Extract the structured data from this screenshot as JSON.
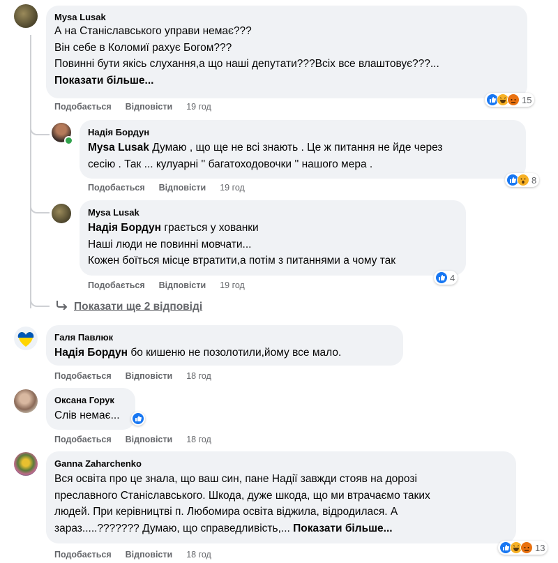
{
  "actions": {
    "like": "Подобається",
    "reply": "Відповісти"
  },
  "comments": [
    {
      "author": "Mysa Lusak",
      "lines": [
        "А на Станіславського управи немає???",
        "Він себе в Коломиї рахує Богом???",
        "Повинні бути якісь слухання,а що наші депутати???Всіх все влаштовує???..."
      ],
      "more": "Показати більше...",
      "time": "19 год",
      "reaction_count": "15",
      "reaction_icons": [
        "like-icon",
        "haha-icon",
        "angry-icon"
      ]
    },
    {
      "author": "Надія Бордун",
      "mention": "Mysa Lusak",
      "line1": "Думаю , що ще не всі знають . Це ж питання не йде через",
      "line2": "сесію . Так ... кулуарні '' багатоходовочки '' нашого мера .",
      "time": "19 год",
      "reaction_count": "8",
      "reaction_icons": [
        "like-icon",
        "wow-icon"
      ]
    },
    {
      "author": "Mysa Lusak",
      "mention": "Надія Бордун",
      "line1": "грається у хованки",
      "line2": "Наші люди не повинні мовчати...",
      "line3": "Кожен боїться місце втратити,а потім з питаннями а чому так",
      "time": "19 год",
      "reaction_count": "4",
      "reaction_icons": [
        "like-icon"
      ]
    },
    {
      "author": "Галя Павлюк",
      "mention": "Надія Бордун",
      "line1": "бо кишеню не позолотили,йому все мало.",
      "time": "18 год"
    },
    {
      "author": "Оксана Горук",
      "line1": "Слів немає...",
      "time": "18 год",
      "reaction_icons": [
        "like-icon"
      ]
    },
    {
      "author": "Ganna Zaharchenko",
      "lines": [
        "Вся освіта про це знала, що ваш син, пане Надії завжди стояв на дорозі",
        "преславного Станіславського. Шкода, дуже шкода, що ми втрачаємо таких",
        "людей. При керівництві п. Любомира освіта віджила, відродилася. А"
      ],
      "last_line": "зараз.....??????? Думаю, що справедливість,...",
      "more": "Показати більше...",
      "time": "18 год",
      "reaction_count": "13",
      "reaction_icons": [
        "like-icon",
        "haha-icon",
        "angry-icon"
      ]
    }
  ],
  "show_replies": "Показати ще 2 відповіді",
  "colors": {
    "like": "#1877f2",
    "bubble": "#f0f2f5",
    "meta": "#65676b",
    "online": "#31a24c"
  }
}
